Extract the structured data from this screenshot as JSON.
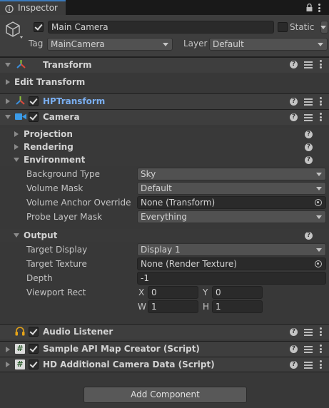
{
  "tab": {
    "title": "Inspector"
  },
  "header": {
    "object_name": "Main Camera",
    "static_label": "Static",
    "tag_label": "Tag",
    "tag_value": "MainCamera",
    "layer_label": "Layer",
    "layer_value": "Default"
  },
  "transform": {
    "title": "Transform",
    "edit_label": "Edit Transform"
  },
  "hptransform": {
    "title": "HPTransform"
  },
  "camera": {
    "title": "Camera",
    "sections": {
      "projection": "Projection",
      "rendering": "Rendering",
      "environment": "Environment",
      "output": "Output"
    },
    "environment": {
      "background_type_label": "Background Type",
      "background_type_value": "Sky",
      "volume_mask_label": "Volume Mask",
      "volume_mask_value": "Default",
      "volume_anchor_label": "Volume Anchor Override",
      "volume_anchor_value": "None (Transform)",
      "probe_layer_label": "Probe Layer Mask",
      "probe_layer_value": "Everything"
    },
    "output": {
      "target_display_label": "Target Display",
      "target_display_value": "Display 1",
      "target_texture_label": "Target Texture",
      "target_texture_value": "None (Render Texture)",
      "depth_label": "Depth",
      "depth_value": "-1",
      "viewport_label": "Viewport Rect",
      "x_label": "X",
      "x_value": "0",
      "y_label": "Y",
      "y_value": "0",
      "w_label": "W",
      "w_value": "1",
      "h_label": "H",
      "h_value": "1"
    }
  },
  "audio_listener": {
    "title": "Audio Listener"
  },
  "sample_api": {
    "title": "Sample API Map Creator (Script)"
  },
  "hd_camera": {
    "title": "HD Additional Camera Data (Script)"
  },
  "add_component": {
    "label": "Add Component"
  },
  "colors": {
    "accent": "#3a79bb",
    "hptransform_title": "#7aaef0",
    "background": "#383838",
    "header": "#3e3e3e",
    "field": "#2a2a2a"
  },
  "icons": {
    "gameobject": "cube-icon",
    "transform": "axes-icon",
    "camera": "camera-icon",
    "audio": "headphones-icon",
    "script": "script-hash-icon"
  }
}
